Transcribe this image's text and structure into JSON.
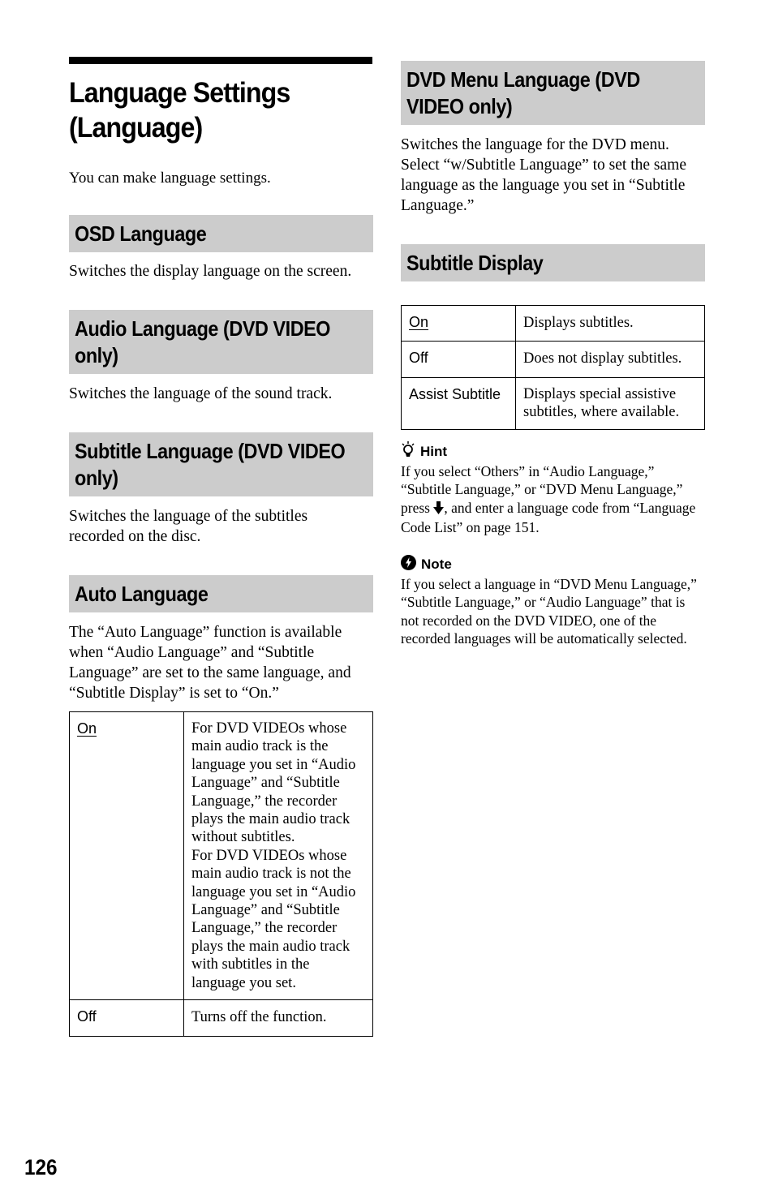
{
  "page": {
    "title": "Language Settings (Language)",
    "title_line1": "Language Settings",
    "title_line2": "(Language)",
    "intro": "You can make language settings.",
    "page_number": "126"
  },
  "sections": {
    "osd": {
      "heading": "OSD Language",
      "body": "Switches the display language on the screen."
    },
    "audio": {
      "heading_line1": "Audio Language (DVD VIDEO",
      "heading_line2": "only)",
      "body": "Switches the language of the sound track."
    },
    "subtitle_lang": {
      "heading_line1": "Subtitle Language (DVD VIDEO",
      "heading_line2": "only)",
      "body": "Switches the language of the subtitles recorded on the disc."
    },
    "auto": {
      "heading": "Auto Language",
      "body": "The “Auto Language” function is available when “Audio Language” and “Subtitle Language” are set to the same language, and “Subtitle Display” is set to “On.”",
      "table": [
        {
          "key": "On",
          "default": true,
          "value_p1": "For DVD VIDEOs whose main audio track is the language you set in “Audio Language” and “Subtitle Language,” the recorder plays the main audio track without subtitles.",
          "value_p2": "For DVD VIDEOs whose main audio track is not the language you set in “Audio Language” and “Subtitle Language,” the recorder plays the main audio track with subtitles in the language you set."
        },
        {
          "key": "Off",
          "default": false,
          "value_p1": "Turns off the function."
        }
      ]
    },
    "dvd_menu": {
      "heading_line1": "DVD Menu Language (DVD",
      "heading_line2": "VIDEO only)",
      "body": "Switches the language for the DVD menu. Select “w/Subtitle Language” to set the same language as the language you set in “Subtitle Language.”"
    },
    "subtitle_display": {
      "heading": "Subtitle Display",
      "table": [
        {
          "key": "On",
          "default": true,
          "value": "Displays subtitles."
        },
        {
          "key": "Off",
          "default": false,
          "value": "Does not display subtitles."
        },
        {
          "key": "Assist Subtitle",
          "default": false,
          "value": "Displays special assistive subtitles, where available."
        }
      ]
    }
  },
  "hint": {
    "icon": "lightbulb-icon",
    "title": "Hint",
    "text_before": "If you select “Others” in “Audio Language,” “Subtitle Language,” or “DVD Menu Language,” press ",
    "arrow_glyph": "🡫",
    "text_after": ", and enter a language code from “Language Code List” on page 151."
  },
  "note": {
    "icon": "note-warning-icon",
    "title": "Note",
    "text": "If you select a language in “DVD Menu Language,” “Subtitle Language,” or “Audio Language” that is not recorded on the DVD VIDEO, one of the recorded languages will be automatically selected."
  }
}
